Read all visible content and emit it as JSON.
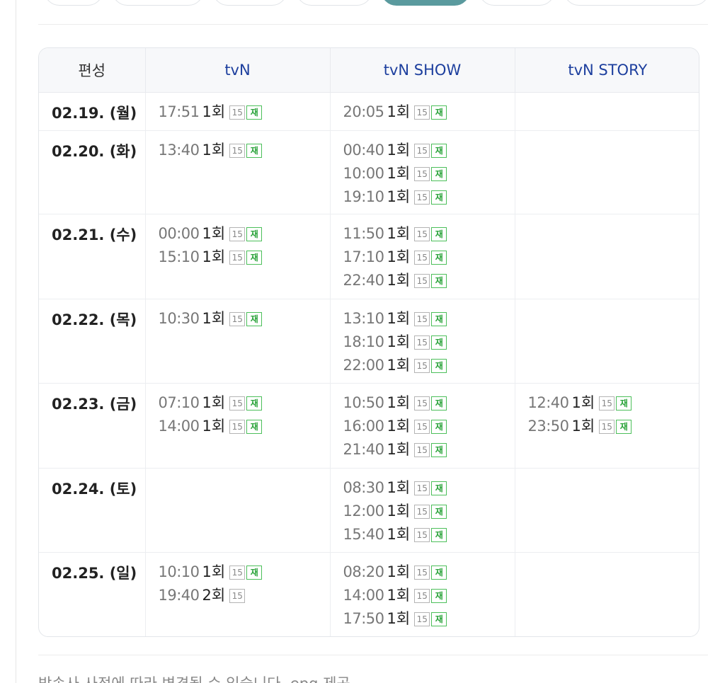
{
  "header": {
    "col_pyeonseong": "편성",
    "channels": [
      "tvN",
      "tvN SHOW",
      "tvN STORY"
    ]
  },
  "badges": {
    "age": "15",
    "rerun": "재"
  },
  "rows": [
    {
      "date": "02.19. (월)",
      "cells": [
        [
          {
            "time": "17:51",
            "ep": "1회",
            "rerun": true
          }
        ],
        [
          {
            "time": "20:05",
            "ep": "1회",
            "rerun": true
          }
        ],
        []
      ]
    },
    {
      "date": "02.20. (화)",
      "cells": [
        [
          {
            "time": "13:40",
            "ep": "1회",
            "rerun": true
          }
        ],
        [
          {
            "time": "00:40",
            "ep": "1회",
            "rerun": true
          },
          {
            "time": "10:00",
            "ep": "1회",
            "rerun": true
          },
          {
            "time": "19:10",
            "ep": "1회",
            "rerun": true
          }
        ],
        []
      ]
    },
    {
      "date": "02.21. (수)",
      "cells": [
        [
          {
            "time": "00:00",
            "ep": "1회",
            "rerun": true
          },
          {
            "time": "15:10",
            "ep": "1회",
            "rerun": true
          }
        ],
        [
          {
            "time": "11:50",
            "ep": "1회",
            "rerun": true
          },
          {
            "time": "17:10",
            "ep": "1회",
            "rerun": true
          },
          {
            "time": "22:40",
            "ep": "1회",
            "rerun": true
          }
        ],
        []
      ]
    },
    {
      "date": "02.22. (목)",
      "cells": [
        [
          {
            "time": "10:30",
            "ep": "1회",
            "rerun": true
          }
        ],
        [
          {
            "time": "13:10",
            "ep": "1회",
            "rerun": true
          },
          {
            "time": "18:10",
            "ep": "1회",
            "rerun": true
          },
          {
            "time": "22:00",
            "ep": "1회",
            "rerun": true
          }
        ],
        []
      ]
    },
    {
      "date": "02.23. (금)",
      "cells": [
        [
          {
            "time": "07:10",
            "ep": "1회",
            "rerun": true
          },
          {
            "time": "14:00",
            "ep": "1회",
            "rerun": true
          }
        ],
        [
          {
            "time": "10:50",
            "ep": "1회",
            "rerun": true
          },
          {
            "time": "16:00",
            "ep": "1회",
            "rerun": true
          },
          {
            "time": "21:40",
            "ep": "1회",
            "rerun": true
          }
        ],
        [
          {
            "time": "12:40",
            "ep": "1회",
            "rerun": true
          },
          {
            "time": "23:50",
            "ep": "1회",
            "rerun": true
          }
        ]
      ]
    },
    {
      "date": "02.24. (토)",
      "cells": [
        [],
        [
          {
            "time": "08:30",
            "ep": "1회",
            "rerun": true
          },
          {
            "time": "12:00",
            "ep": "1회",
            "rerun": true
          },
          {
            "time": "15:40",
            "ep": "1회",
            "rerun": true
          }
        ],
        []
      ]
    },
    {
      "date": "02.25. (일)",
      "cells": [
        [
          {
            "time": "10:10",
            "ep": "1회",
            "rerun": true
          },
          {
            "time": "19:40",
            "ep": "2회",
            "rerun": false
          }
        ],
        [
          {
            "time": "08:20",
            "ep": "1회",
            "rerun": true
          },
          {
            "time": "14:00",
            "ep": "1회",
            "rerun": true
          },
          {
            "time": "17:50",
            "ep": "1회",
            "rerun": true
          }
        ],
        []
      ]
    }
  ],
  "footer": {
    "note": "방송사 사정에 따라 변경될 수 있습니다. epg 제공"
  },
  "colors": {
    "active_tab": "#5a9a9e",
    "channel_header": "#1d3f9e",
    "rerun_badge": "#2aa33a"
  }
}
